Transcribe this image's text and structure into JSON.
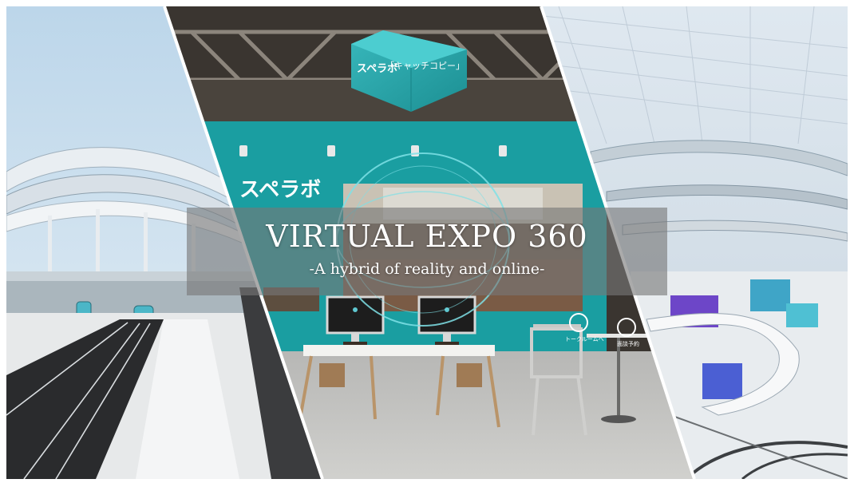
{
  "hero": {
    "title": "VIRTUAL EXPO 360",
    "subtitle": "-A hybrid of reality and online-"
  },
  "booth": {
    "logo_text": "スペラボ",
    "sign_logo": "スペラボ",
    "sign_copy": "「キャッチコピー」",
    "icon_labels": [
      "トークルームへ",
      "面談予約"
    ]
  },
  "colors": {
    "booth_teal": "#1a9ea1",
    "sky": "#cfe2ef",
    "banner": "rgba(120,120,120,0.62)"
  }
}
